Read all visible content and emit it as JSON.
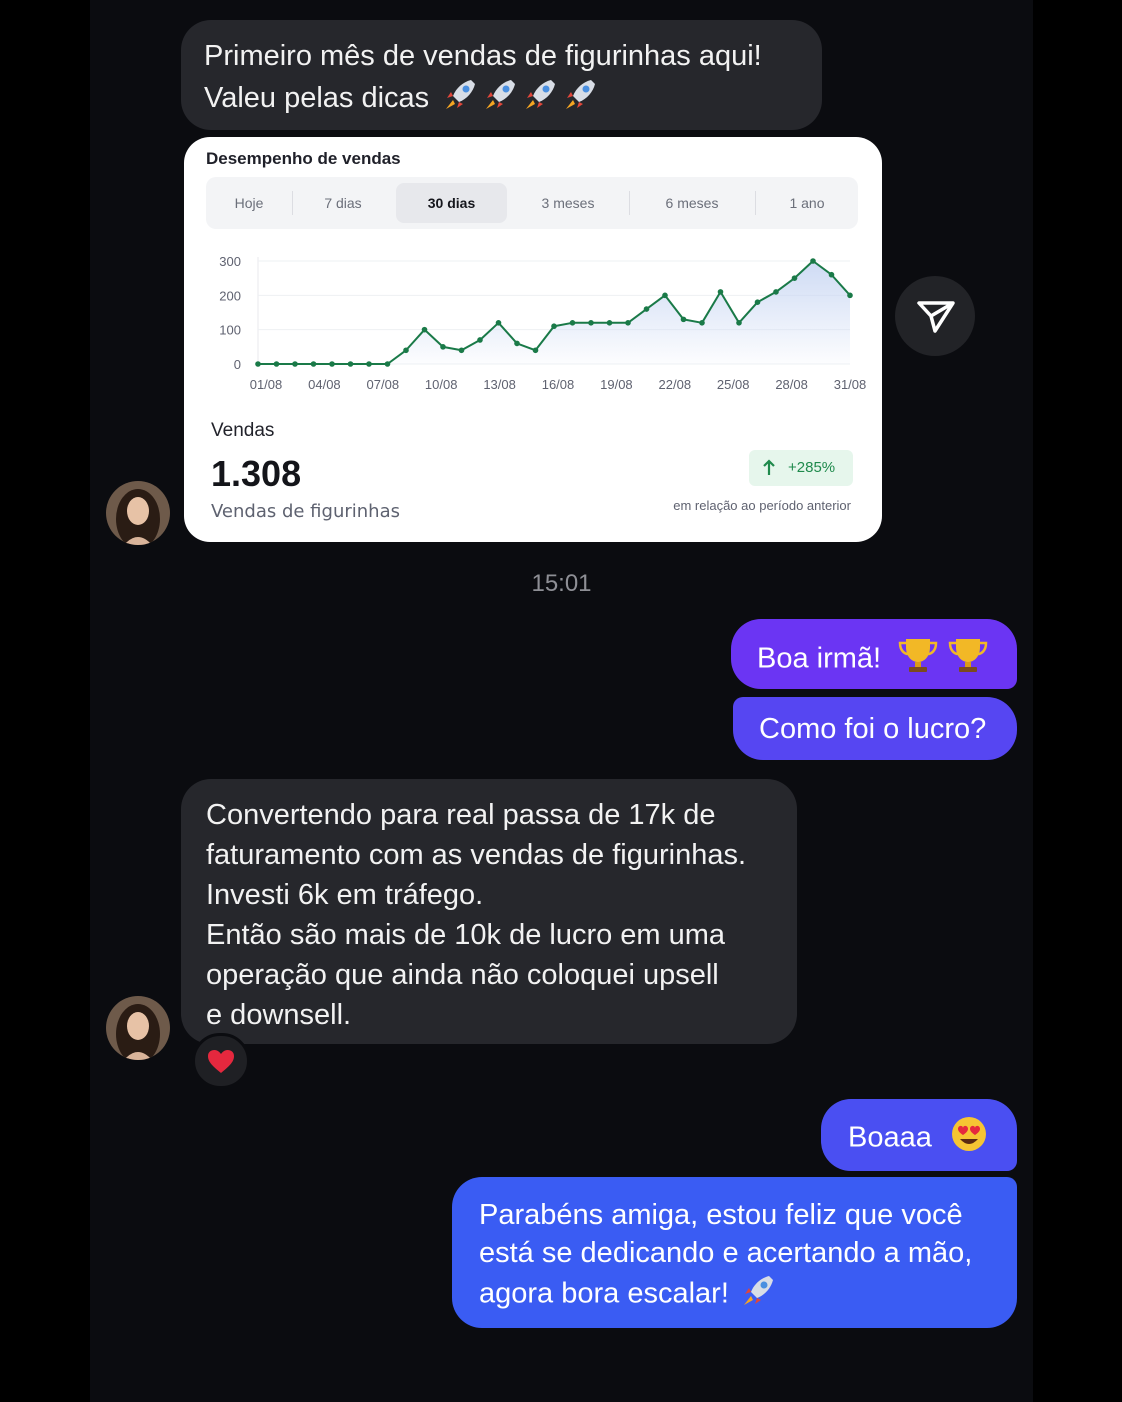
{
  "messages": {
    "m1": {
      "line1": "Primeiro mês de vendas de figurinhas aqui!",
      "line2": "Valeu pelas dicas"
    },
    "m2": {
      "text": "Boa irmã!"
    },
    "m3": {
      "text": "Como foi o lucro?"
    },
    "m4": {
      "lines": [
        "Convertendo para real passa de 17k de",
        "faturamento com as vendas de figurinhas.",
        "Investi 6k em tráfego.",
        "Então são mais de 10k de lucro em uma",
        "operação que ainda não coloquei upsell",
        "e downsell."
      ]
    },
    "m5": {
      "text": "Boaaa"
    },
    "m6": {
      "lines": [
        "Parabéns amiga, estou feliz que você",
        "está se dedicando e acertando a mão,",
        "agora bora escalar!"
      ]
    }
  },
  "timestamp": "15:01",
  "reaction": {
    "icon": "heart-icon"
  },
  "card": {
    "title": "Desempenho de vendas",
    "tabs": [
      "Hoje",
      "7 dias",
      "30 dias",
      "3 meses",
      "6 meses",
      "1 ano"
    ],
    "active_tab": "30 dias",
    "stat_label": "Vendas",
    "stat_value": "1.308",
    "stat_sub": "Vendas de figurinhas",
    "delta": "+285%",
    "delta_note": "em relação ao período anterior"
  },
  "chart_data": {
    "type": "area",
    "x": [
      "01/08",
      "02/08",
      "03/08",
      "04/08",
      "05/08",
      "06/08",
      "07/08",
      "08/08",
      "09/08",
      "10/08",
      "11/08",
      "12/08",
      "13/08",
      "14/08",
      "15/08",
      "16/08",
      "17/08",
      "18/08",
      "19/08",
      "20/08",
      "21/08",
      "22/08",
      "23/08",
      "24/08",
      "25/08",
      "26/08",
      "27/08",
      "28/08",
      "29/08",
      "30/08",
      "31/08"
    ],
    "x_tick_labels": [
      "01/08",
      "04/08",
      "07/08",
      "10/08",
      "13/08",
      "16/08",
      "19/08",
      "22/08",
      "25/08",
      "28/08",
      "31/08"
    ],
    "values": [
      0,
      0,
      0,
      0,
      0,
      0,
      0,
      0,
      40,
      100,
      50,
      40,
      70,
      120,
      60,
      40,
      110,
      120,
      120,
      120,
      120,
      160,
      200,
      130,
      120,
      210,
      120,
      180,
      210,
      250,
      300,
      260,
      200
    ],
    "yticks": [
      0,
      100,
      200,
      300
    ],
    "ylim": [
      0,
      300
    ],
    "grid": true,
    "colors": {
      "line": "#1a7a48",
      "fill": "#c9d7f3"
    }
  },
  "colors": {
    "accent_purple": "#6b35f3",
    "accent_blue": "#3a5cf3",
    "incoming": "#26272c",
    "background": "#0b0c10"
  }
}
